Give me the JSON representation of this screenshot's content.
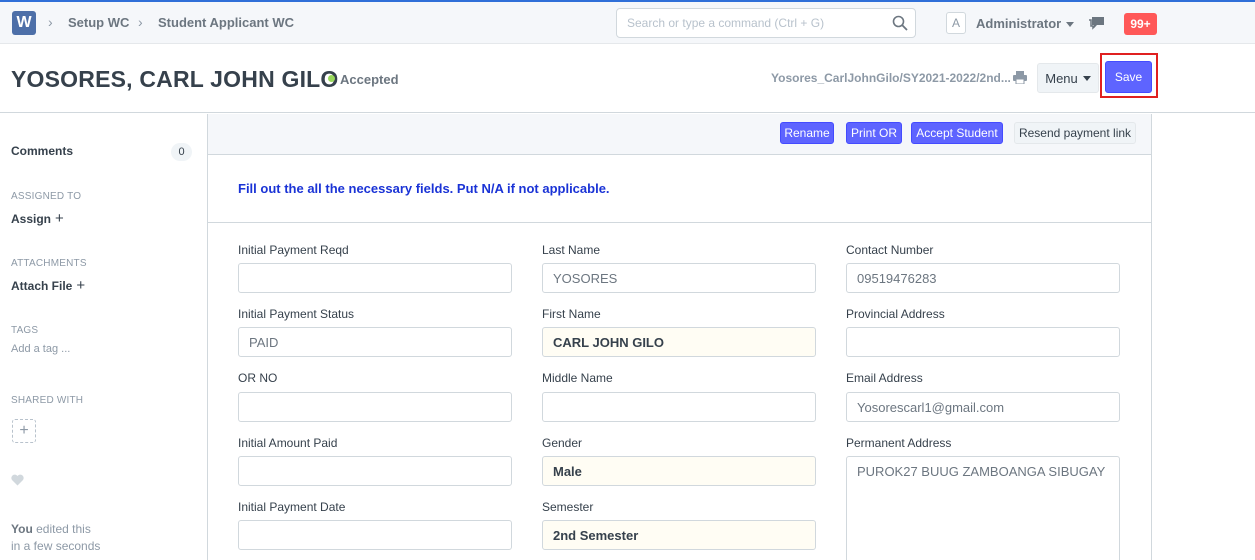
{
  "navbar": {
    "logo": "W",
    "breadcrumbs": [
      "Setup WC",
      "Student Applicant WC"
    ],
    "search_placeholder": "Search or type a command (Ctrl + G)",
    "avatar_letter": "A",
    "user": "Administrator",
    "notifications": "99+"
  },
  "page": {
    "title": "YOSORES, CARL JOHN GILO",
    "status": "Accepted",
    "doc_name": "Yosores_CarlJohnGilo/SY2021-2022/2nd...",
    "menu_label": "Menu",
    "save_label": "Save"
  },
  "sidebar": {
    "comments_label": "Comments",
    "comments_count": "0",
    "assigned_to": "ASSIGNED TO",
    "assign": "Assign",
    "attachments": "ATTACHMENTS",
    "attach_file": "Attach File",
    "tags": "TAGS",
    "add_tag": "Add a tag ...",
    "shared_with": "SHARED WITH",
    "edit_who": "You",
    "edit_action": "edited this",
    "edit_time": "in a few seconds"
  },
  "toolbar": {
    "rename": "Rename",
    "print_or": "Print OR",
    "accept_student": "Accept Student",
    "resend_link": "Resend payment link"
  },
  "form": {
    "intro": "Fill out the all the necessary fields. Put N/A if not applicable.",
    "col1": [
      {
        "label": "Initial Payment Reqd",
        "value": ""
      },
      {
        "label": "Initial Payment Status",
        "value": "PAID"
      },
      {
        "label": "OR NO",
        "value": ""
      },
      {
        "label": "Initial Amount Paid",
        "value": ""
      },
      {
        "label": "Initial Payment Date",
        "value": ""
      }
    ],
    "col2": [
      {
        "label": "Last Name",
        "value": "YOSORES"
      },
      {
        "label": "First Name",
        "value": "CARL JOHN GILO"
      },
      {
        "label": "Middle Name",
        "value": ""
      },
      {
        "label": "Gender",
        "value": "Male"
      },
      {
        "label": "Semester",
        "value": "2nd Semester"
      }
    ],
    "col3": [
      {
        "label": "Contact Number",
        "value": "09519476283"
      },
      {
        "label": "Provincial Address",
        "value": ""
      },
      {
        "label": "Email Address",
        "value": "Yosorescarl1@gmail.com"
      },
      {
        "label": "Permanent Address",
        "value": "PUROK27 BUUG ZAMBOANGA SIBUGAY"
      }
    ]
  }
}
